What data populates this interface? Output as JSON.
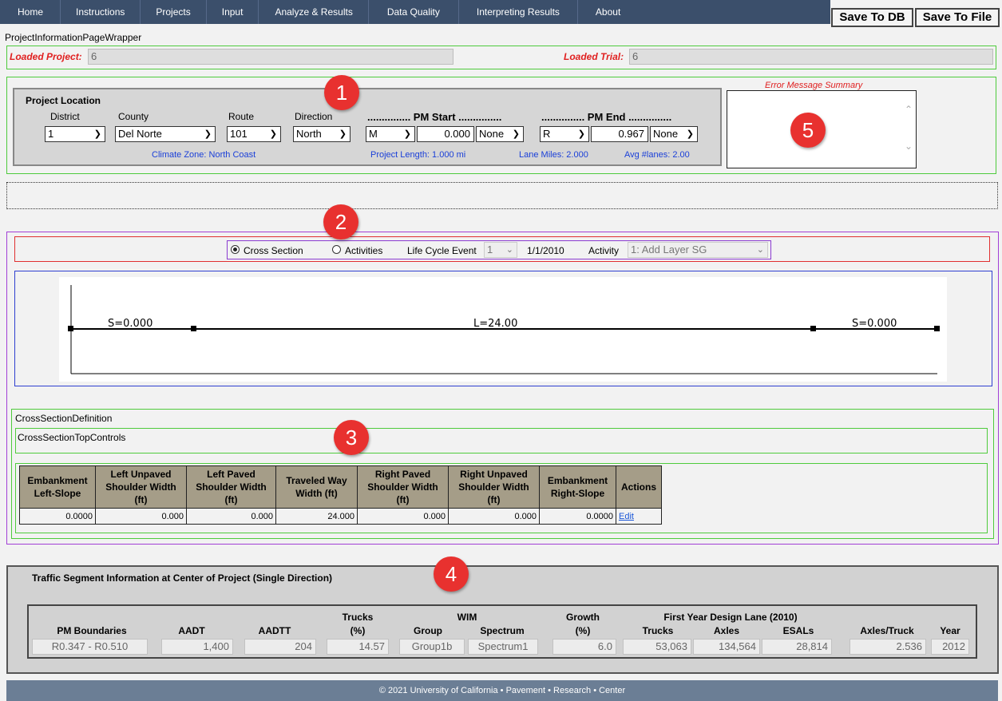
{
  "nav": {
    "items": [
      "Home",
      "Instructions",
      "Projects",
      "Input",
      "Analyze & Results",
      "Data Quality",
      "Interpreting Results",
      "About"
    ],
    "save_db": "Save To DB",
    "save_file": "Save To File"
  },
  "wrapper_label": "ProjectInformationPageWrapper",
  "loaded": {
    "project_label": "Loaded Project:",
    "project_value": "6",
    "trial_label": "Loaded Trial:",
    "trial_value": "6"
  },
  "location": {
    "legend": "Project Location",
    "district_label": "District",
    "district": "1",
    "county_label": "County",
    "county": "Del Norte",
    "route_label": "Route",
    "route": "101",
    "direction_label": "Direction",
    "direction": "North",
    "pm_start_label": "............... PM Start ...............",
    "pm_start_prefix": "M",
    "pm_start_value": "0.000",
    "pm_start_suffix": "None",
    "pm_end_label": "............... PM End ...............",
    "pm_end_prefix": "R",
    "pm_end_value": "0.967",
    "pm_end_suffix": "None",
    "climate_zone": "Climate Zone: North Coast",
    "project_length": "Project Length: 1.000 mi",
    "lane_miles": "Lane Miles: 2.000",
    "avg_lanes": "Avg #lanes: 2.00"
  },
  "error_summary": {
    "title": "Error Message Summary"
  },
  "badges": [
    "1",
    "2",
    "3",
    "4",
    "5"
  ],
  "mode_bar": {
    "cross_section": "Cross Section",
    "activities": "Activities",
    "life_cycle_label": "Life Cycle Event",
    "life_cycle_value": "1",
    "date": "1/1/2010",
    "activity_label": "Activity",
    "activity_value": "1: Add Layer SG",
    "selected_mode": "Cross Section"
  },
  "diagram": {
    "left_label": "S=0.000",
    "center_label": "L=24.00",
    "right_label": "S=0.000"
  },
  "cross_section_def": {
    "label": "CrossSectionDefinition",
    "top_controls_label": "CrossSectionTopControls",
    "headers": [
      "Embankment Left-Slope",
      "Left Unpaved Shoulder Width (ft)",
      "Left Paved Shoulder Width (ft)",
      "Traveled Way Width (ft)",
      "Right Paved Shoulder Width (ft)",
      "Right Unpaved Shoulder Width (ft)",
      "Embankment Right-Slope",
      "Actions"
    ],
    "row": [
      "0.0000",
      "0.000",
      "0.000",
      "24.000",
      "0.000",
      "0.000",
      "0.0000"
    ],
    "edit_link": "Edit"
  },
  "traffic": {
    "legend": "Traffic Segment Information at Center of Project (Single Direction)",
    "group_trucks": "Trucks",
    "group_wim": "WIM",
    "group_growth": "Growth",
    "group_first_year": "First Year Design Lane (2010)",
    "headers": {
      "pm_boundaries": "PM Boundaries",
      "aadt": "AADT",
      "aadtt": "AADTT",
      "trucks_pct": "(%)",
      "group": "Group",
      "spectrum": "Spectrum",
      "growth_pct": "(%)",
      "trucks": "Trucks",
      "axles": "Axles",
      "esals": "ESALs",
      "axles_truck": "Axles/Truck",
      "year": "Year"
    },
    "values": {
      "pm_boundaries": "R0.347 - R0.510",
      "aadt": "1,400",
      "aadtt": "204",
      "trucks_pct": "14.57",
      "group": "Group1b",
      "spectrum": "Spectrum1",
      "growth_pct": "6.0",
      "trucks": "53,063",
      "axles": "134,564",
      "esals": "28,814",
      "axles_truck": "2.536",
      "year": "2012"
    }
  },
  "footer": "© 2021 University of California • Pavement • Research • Center"
}
